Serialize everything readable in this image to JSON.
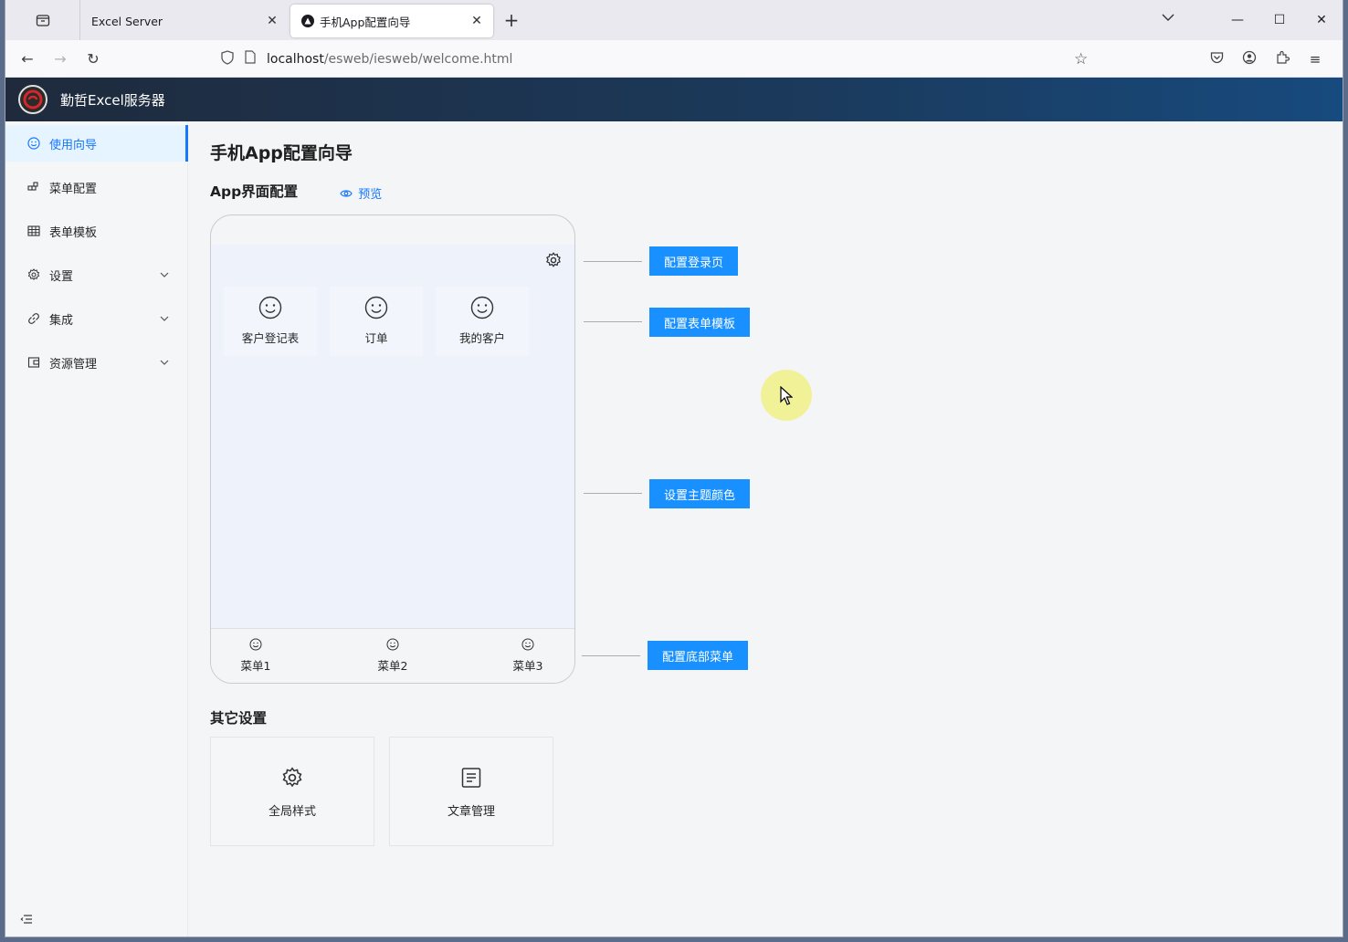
{
  "browser": {
    "tabs": [
      {
        "title": "Excel Server",
        "active": false
      },
      {
        "title": "手机App配置向导",
        "active": true
      }
    ],
    "url_host": "localhost",
    "url_path": "/esweb/iesweb/welcome.html"
  },
  "app": {
    "title": "勤哲Excel服务器"
  },
  "sidebar": {
    "items": [
      {
        "label": "使用向导",
        "icon": "smile-icon",
        "selected": true,
        "expandable": false
      },
      {
        "label": "菜单配置",
        "icon": "blocks-icon",
        "selected": false,
        "expandable": false
      },
      {
        "label": "表单模板",
        "icon": "table-icon",
        "selected": false,
        "expandable": false
      },
      {
        "label": "设置",
        "icon": "gear-icon",
        "selected": false,
        "expandable": true
      },
      {
        "label": "集成",
        "icon": "link-icon",
        "selected": false,
        "expandable": true
      },
      {
        "label": "资源管理",
        "icon": "folder-icon",
        "selected": false,
        "expandable": true
      }
    ]
  },
  "main": {
    "page_title": "手机App配置向导",
    "app_section_title": "App界面配置",
    "preview_label": "预览",
    "phone": {
      "grid_items": [
        "客户登记表",
        "订单",
        "我的客户"
      ],
      "tabbar_items": [
        "菜单1",
        "菜单2",
        "菜单3"
      ]
    },
    "config_buttons": {
      "login": "配置登录页",
      "form_template": "配置表单模板",
      "theme": "设置主题颜色",
      "bottom_menu": "配置底部菜单"
    },
    "other_section_title": "其它设置",
    "other_cards": [
      "全局样式",
      "文章管理"
    ]
  },
  "colors": {
    "primary": "#1890ff",
    "selected_bg": "#e6f4ff",
    "header_dark": "#1f2a3c",
    "header_blue": "#174a7e"
  }
}
